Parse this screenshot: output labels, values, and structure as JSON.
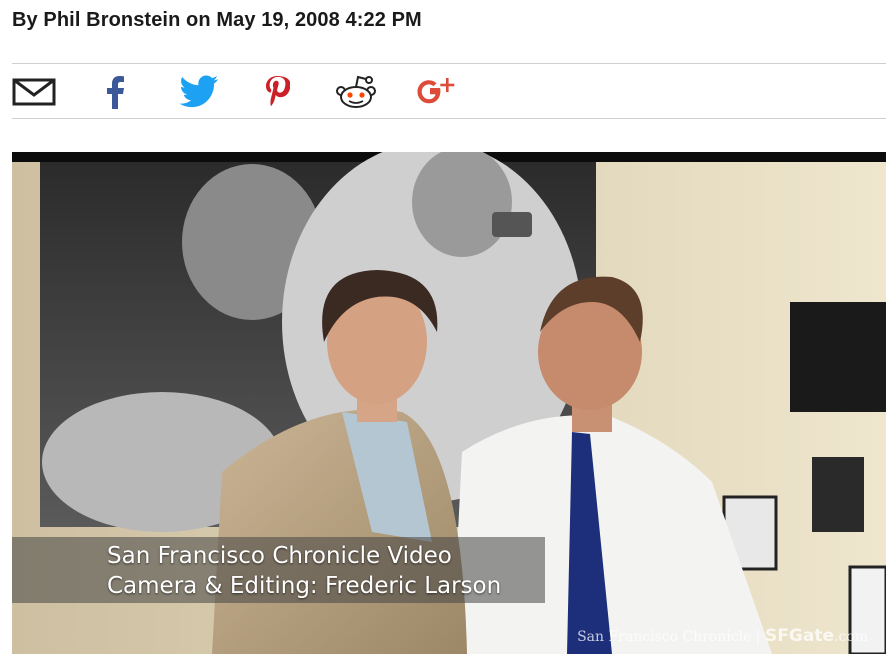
{
  "article": {
    "byline": "By Phil Bronstein on May 19, 2008 4:22 PM"
  },
  "share": {
    "icons": [
      "email-icon",
      "facebook-icon",
      "twitter-icon",
      "pinterest-icon",
      "reddit-icon",
      "google-plus-icon"
    ],
    "colors": {
      "email": "#222222",
      "facebook": "#3b5998",
      "twitter": "#1da1f2",
      "pinterest": "#cb2027",
      "reddit": "#222222",
      "google_plus": "#dd4b39"
    }
  },
  "video": {
    "caption_line1": "San Francisco Chronicle Video",
    "caption_line2": "Camera & Editing: Frederic Larson",
    "watermark_source": "San Francisco Chronicle",
    "watermark_brand": "SFGate",
    "watermark_suffix": ".com"
  }
}
